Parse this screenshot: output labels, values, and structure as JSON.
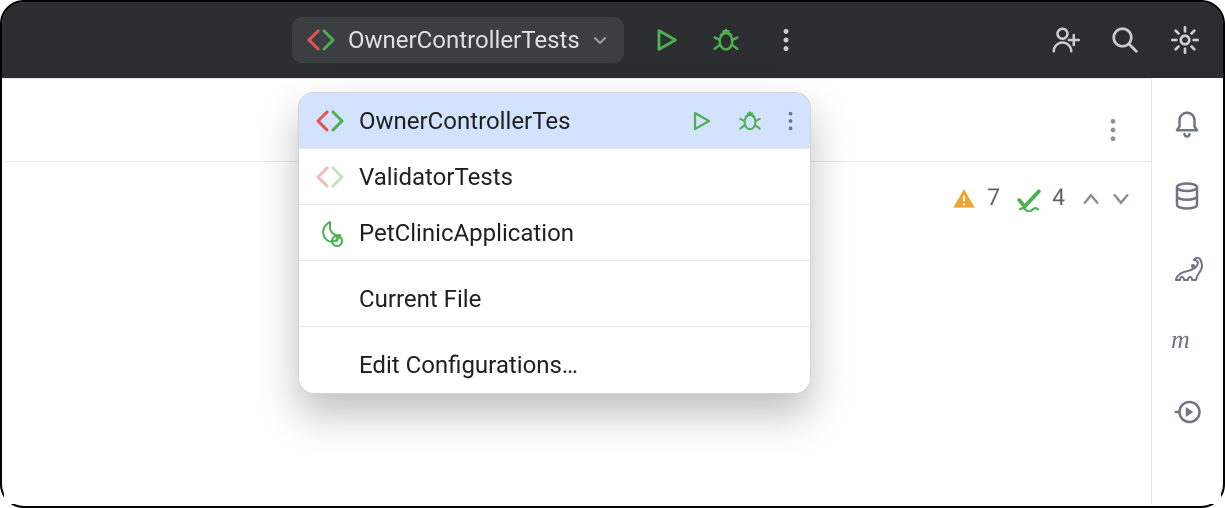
{
  "toolbar": {
    "run_configuration_label": "OwnerControllerTests"
  },
  "popup": {
    "items": [
      {
        "label": "OwnerControllerTes"
      },
      {
        "label": "ValidatorTests"
      },
      {
        "label": "PetClinicApplication"
      }
    ],
    "current_file_label": "Current File",
    "edit_configs_label": "Edit Configurations…"
  },
  "problems": {
    "warning_count": "7",
    "weak_warning_count": "4"
  }
}
